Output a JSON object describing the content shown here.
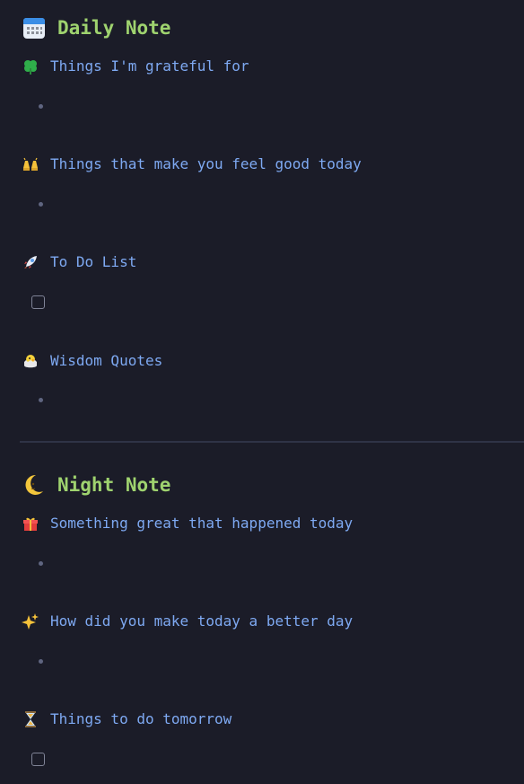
{
  "daily": {
    "title": "Daily Note",
    "icon": "calendar-icon",
    "sections": [
      {
        "label": "Things I'm grateful for",
        "icon": "clover-icon",
        "item": "bullet"
      },
      {
        "label": "Things that make you feel good today",
        "icon": "raised-hands-icon",
        "item": "bullet"
      },
      {
        "label": "To Do List",
        "icon": "rocket-icon",
        "item": "checkbox"
      },
      {
        "label": "Wisdom Quotes",
        "icon": "hatching-chick-icon",
        "item": "bullet"
      }
    ]
  },
  "night": {
    "title": "Night Note",
    "icon": "crescent-moon-icon",
    "sections": [
      {
        "label": "Something great that happened today",
        "icon": "gift-icon",
        "item": "bullet"
      },
      {
        "label": "How did you make today a better day",
        "icon": "sparkles-icon",
        "item": "bullet"
      },
      {
        "label": "Things to do tomorrow",
        "icon": "hourglass-icon",
        "item": "checkbox"
      }
    ]
  }
}
